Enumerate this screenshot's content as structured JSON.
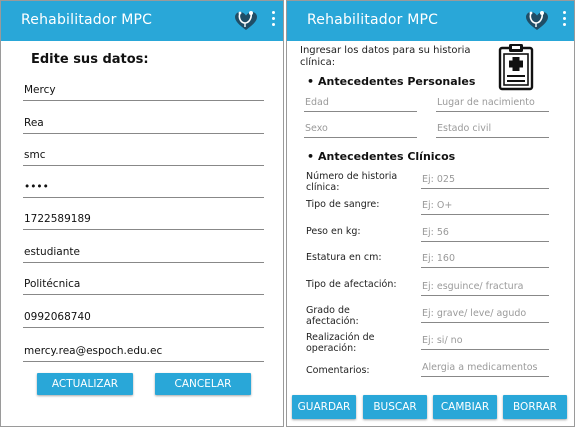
{
  "left_screen": {
    "appbar": {
      "title": "Rehabilitador MPC",
      "icon": "heart-stethoscope-icon",
      "menu_icon": "more-vert-icon"
    },
    "heading": "Edite sus datos:",
    "fields": [
      {
        "value": "Mercy"
      },
      {
        "value": "Rea"
      },
      {
        "value": "smc"
      },
      {
        "value": "••••"
      },
      {
        "value": "1722589189"
      },
      {
        "value": "estudiante"
      },
      {
        "value": "Politécnica"
      },
      {
        "value": "0992068740"
      },
      {
        "value": "mercy.rea@espoch.edu.ec"
      }
    ],
    "buttons": {
      "update": "ACTUALIZAR",
      "cancel": "CANCELAR"
    }
  },
  "right_screen": {
    "appbar": {
      "title": "Rehabilitador MPC",
      "icon": "heart-stethoscope-icon",
      "menu_icon": "more-vert-icon"
    },
    "intro": "Ingresar los datos para su historia clínica:",
    "clipboard_icon": "medical-clipboard-icon",
    "personal_section": {
      "title": "Antecedentes Personales",
      "edad_hint": "Edad",
      "lugar_hint": "Lugar de nacimiento",
      "sexo_hint": "Sexo",
      "estado_hint": "Estado civil"
    },
    "clinical_section": {
      "title": "Antecedentes Clínicos",
      "rows": [
        {
          "label": "Número de historia clínica:",
          "hint": "Ej: 025"
        },
        {
          "label": "Tipo de sangre:",
          "hint": "Ej: O+"
        },
        {
          "label": "Peso en kg:",
          "hint": "Ej: 56"
        },
        {
          "label": "Estatura en cm:",
          "hint": "Ej: 160"
        },
        {
          "label": "Tipo de afectación:",
          "hint": "Ej: esguince/ fractura"
        },
        {
          "label": "Grado de afectación:",
          "hint": "Ej: grave/ leve/ agudo"
        },
        {
          "label": "Realización de operación:",
          "hint": "Ej: si/ no"
        },
        {
          "label": "Comentarios:",
          "hint": "Alergia a medicamentos"
        }
      ]
    },
    "buttons": {
      "save": "GUARDAR",
      "search": "BUSCAR",
      "change": "CAMBIAR",
      "delete": "BORRAR"
    }
  },
  "colors": {
    "accent": "#29a7d8",
    "heart": "#1f4d66"
  }
}
